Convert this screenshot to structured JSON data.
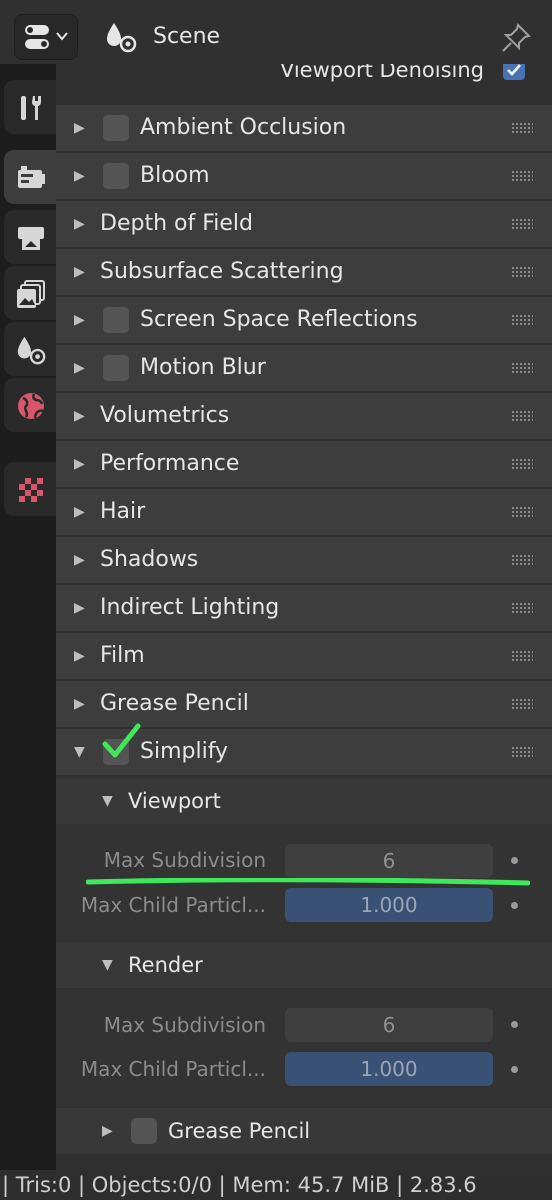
{
  "header": {
    "scene_label": "Scene"
  },
  "panel": {
    "denoising": {
      "label": "Viewport Denoising",
      "checked": true
    },
    "sections": [
      {
        "label": "Ambient Occlusion",
        "checkbox": true,
        "checked": false,
        "expanded": false
      },
      {
        "label": "Bloom",
        "checkbox": true,
        "checked": false,
        "expanded": false
      },
      {
        "label": "Depth of Field",
        "checkbox": false,
        "expanded": false
      },
      {
        "label": "Subsurface Scattering",
        "checkbox": false,
        "expanded": false
      },
      {
        "label": "Screen Space Reflections",
        "checkbox": true,
        "checked": false,
        "expanded": false
      },
      {
        "label": "Motion Blur",
        "checkbox": true,
        "checked": false,
        "expanded": false
      },
      {
        "label": "Volumetrics",
        "checkbox": false,
        "expanded": false
      },
      {
        "label": "Performance",
        "checkbox": false,
        "expanded": false
      },
      {
        "label": "Hair",
        "checkbox": false,
        "expanded": false
      },
      {
        "label": "Shadows",
        "checkbox": false,
        "expanded": false
      },
      {
        "label": "Indirect Lighting",
        "checkbox": false,
        "expanded": false
      },
      {
        "label": "Film",
        "checkbox": false,
        "expanded": false
      },
      {
        "label": "Grease Pencil",
        "checkbox": false,
        "expanded": false
      },
      {
        "label": "Simplify",
        "checkbox": true,
        "checked": false,
        "expanded": true
      }
    ],
    "simplify": {
      "viewport": {
        "label": "Viewport",
        "max_subdivision_label": "Max Subdivision",
        "max_subdivision_value": "6",
        "max_child_particles_label": "Max Child Particl...",
        "max_child_particles_value": "1.000"
      },
      "render": {
        "label": "Render",
        "max_subdivision_label": "Max Subdivision",
        "max_subdivision_value": "6",
        "max_child_particles_label": "Max Child Particl...",
        "max_child_particles_value": "1.000"
      },
      "grease_pencil": {
        "label": "Grease Pencil",
        "checked": false
      }
    }
  },
  "status_bar": {
    "text": "| Tris:0 | Objects:0/0 | Mem: 45.7 MiB | 2.83.6"
  },
  "tabs": [
    "tool-icon",
    "render-icon",
    "output-icon",
    "view-layer-icon",
    "scene-icon",
    "world-icon",
    "texture-icon"
  ],
  "colors": {
    "accent_blue": "#4772b3",
    "annotation_green": "#3ee85a",
    "world_red": "#d8566b"
  }
}
